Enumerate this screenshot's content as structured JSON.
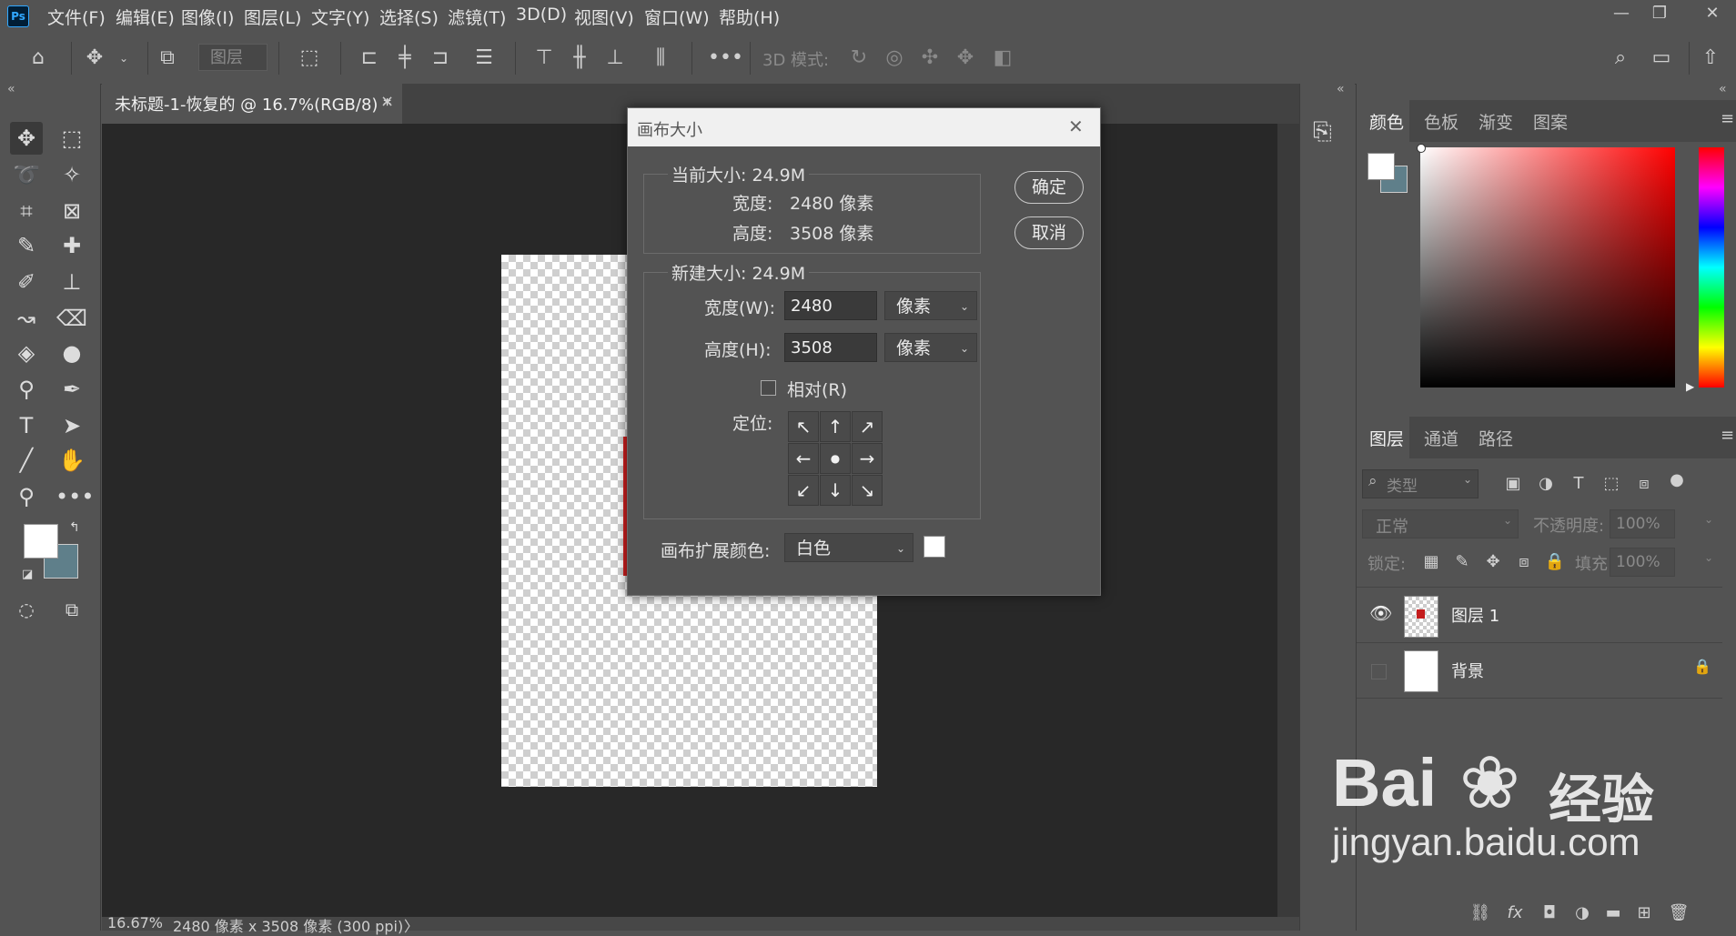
{
  "app": {
    "logo": "Ps"
  },
  "menu": [
    "文件(F)",
    "编辑(E)",
    "图像(I)",
    "图层(L)",
    "文字(Y)",
    "选择(S)",
    "滤镜(T)",
    "3D(D)",
    "视图(V)",
    "窗口(W)",
    "帮助(H)"
  ],
  "window_controls": {
    "minimize": "—",
    "restore": "❐",
    "close": "✕"
  },
  "options_bar": {
    "layer_dropdown": "图层",
    "mode_3d_label": "3D 模式:"
  },
  "document": {
    "tab_title": "未标题-1-恢复的 @ 16.7%(RGB/8) *",
    "tab_close": "×",
    "status_zoom": "16.67%",
    "status_info": "2480 像素 x 3508 像素 (300 ppi)",
    "status_arrow": "〉"
  },
  "dialog": {
    "title": "画布大小",
    "current_size_label": "当前大小: 24.9M",
    "current_width_label": "宽度:",
    "current_width_value": "2480 像素",
    "current_height_label": "高度:",
    "current_height_value": "3508 像素",
    "new_size_label": "新建大小: 24.9M",
    "width_label": "宽度(W):",
    "width_value": "2480",
    "width_unit": "像素",
    "height_label": "高度(H):",
    "height_value": "3508",
    "height_unit": "像素",
    "relative_label": "相对(R)",
    "relative_checked": false,
    "anchor_label": "定位:",
    "anchor_arrows": [
      "↖",
      "↑",
      "↗",
      "←",
      "●",
      "→",
      "↙",
      "↓",
      "↘"
    ],
    "ext_color_label": "画布扩展颜色:",
    "ext_color_value": "白色",
    "ext_color_swatch": "#ffffff",
    "ok_label": "确定",
    "cancel_label": "取消",
    "close": "✕"
  },
  "color_panel": {
    "tabs": [
      "颜色",
      "色板",
      "渐变",
      "图案"
    ],
    "foreground": "#ffffff",
    "background": "#5f7f8a",
    "hue_color": "#ff0000"
  },
  "layers_panel": {
    "tabs": [
      "图层",
      "通道",
      "路径"
    ],
    "filter_placeholder": "类型",
    "blend_mode": "正常",
    "opacity_label": "不透明度:",
    "opacity_value": "100%",
    "lock_label": "锁定:",
    "fill_label": "填充:",
    "fill_value": "100%",
    "layers": [
      {
        "name": "图层 1",
        "visible": true,
        "locked": false
      },
      {
        "name": "背景",
        "visible": false,
        "locked": true
      }
    ]
  },
  "watermark": {
    "brand": "Bai",
    "brand_suffix": "经验",
    "url": "jingyan.baidu.com"
  }
}
